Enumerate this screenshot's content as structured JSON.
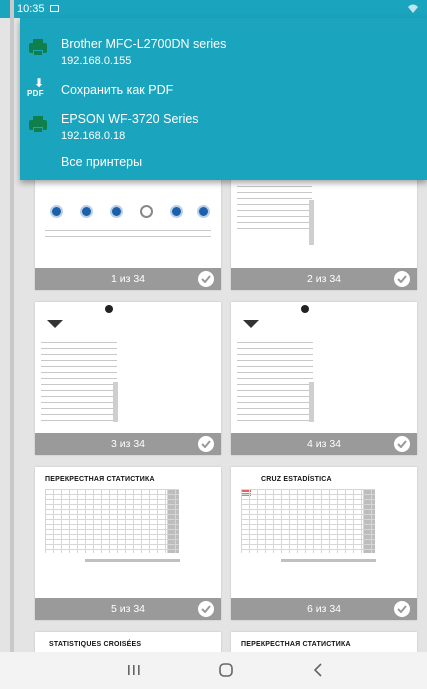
{
  "status_bar": {
    "time": "10:35"
  },
  "printer_menu": {
    "options": [
      {
        "name": "Brother MFC-L2700DN series",
        "address": "192.168.0.155",
        "icon": "printer-icon"
      },
      {
        "name": "Сохранить как PDF",
        "icon": "pdf-download-icon",
        "icon_text": "PDF"
      },
      {
        "name": "EPSON WF-3720 Series",
        "address": "192.168.0.18",
        "icon": "printer-icon"
      },
      {
        "name": "Все принтеры"
      }
    ]
  },
  "pages": [
    {
      "label": "1 из 34",
      "selected": true
    },
    {
      "label": "2 из 34",
      "selected": true
    },
    {
      "label": "3 из 34",
      "selected": true
    },
    {
      "label": "4 из 34",
      "selected": true
    },
    {
      "label": "5 из 34",
      "selected": true,
      "doc_title": "ПЕРЕКРЕСТНАЯ   СТАТИСТИКА"
    },
    {
      "label": "6 из 34",
      "selected": true,
      "doc_title": "CRUZ        ESTADÍSTICA"
    },
    {
      "doc_title": "STATISTIQUES   CROISÉES"
    },
    {
      "doc_title": "ПЕРЕКРЕСТНАЯ   СТАТИСТИКА"
    }
  ],
  "colors": {
    "accent": "#1ba4bd",
    "printer_icon": "#0f7f4c",
    "footer": "#9a9a9a"
  },
  "nav_bar": {
    "recent": "recent-apps-icon",
    "home": "home-icon",
    "back": "back-icon"
  }
}
